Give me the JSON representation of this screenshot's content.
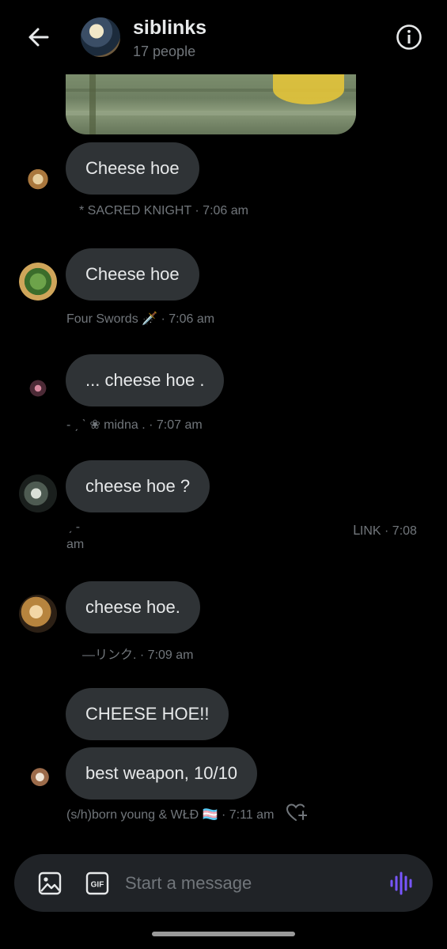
{
  "header": {
    "title": "siblinks",
    "subtitle": "17 people",
    "back_icon": "arrow-left-icon",
    "info_icon": "info-icon"
  },
  "messages": [
    {
      "text": "Cheese hoe",
      "meta": "*        SACRED KNIGHT · 7:06 am"
    },
    {
      "text": "Cheese hoe",
      "meta": "Four Swords 🗡️ · 7:06 am"
    },
    {
      "text": "... cheese hoe .",
      "meta": "- ˏ ˋ ❀ midna . · 7:07 am"
    },
    {
      "text": "cheese hoe ?",
      "meta_left": "ˏ -",
      "meta_right": "ᒪINK · 7:08",
      "meta_wrap": "am"
    },
    {
      "text": "cheese hoe.",
      "meta": "—リンク. · 7:09 am"
    },
    {
      "text": "CHEESE HOE!!"
    },
    {
      "text": "best weapon, 10/10",
      "meta": "(s/h)born young & WŁÐ 🏳️‍⚧️ · 7:11 am"
    }
  ],
  "composer": {
    "placeholder": "Start a message",
    "image_icon": "image-icon",
    "gif_icon": "gif-icon",
    "voice_icon": "voice-waveform-icon"
  },
  "colors": {
    "background": "#000000",
    "bubble": "#2f3336",
    "text": "#e7e9ea",
    "muted": "#71767b",
    "accent": "#7856ff"
  }
}
